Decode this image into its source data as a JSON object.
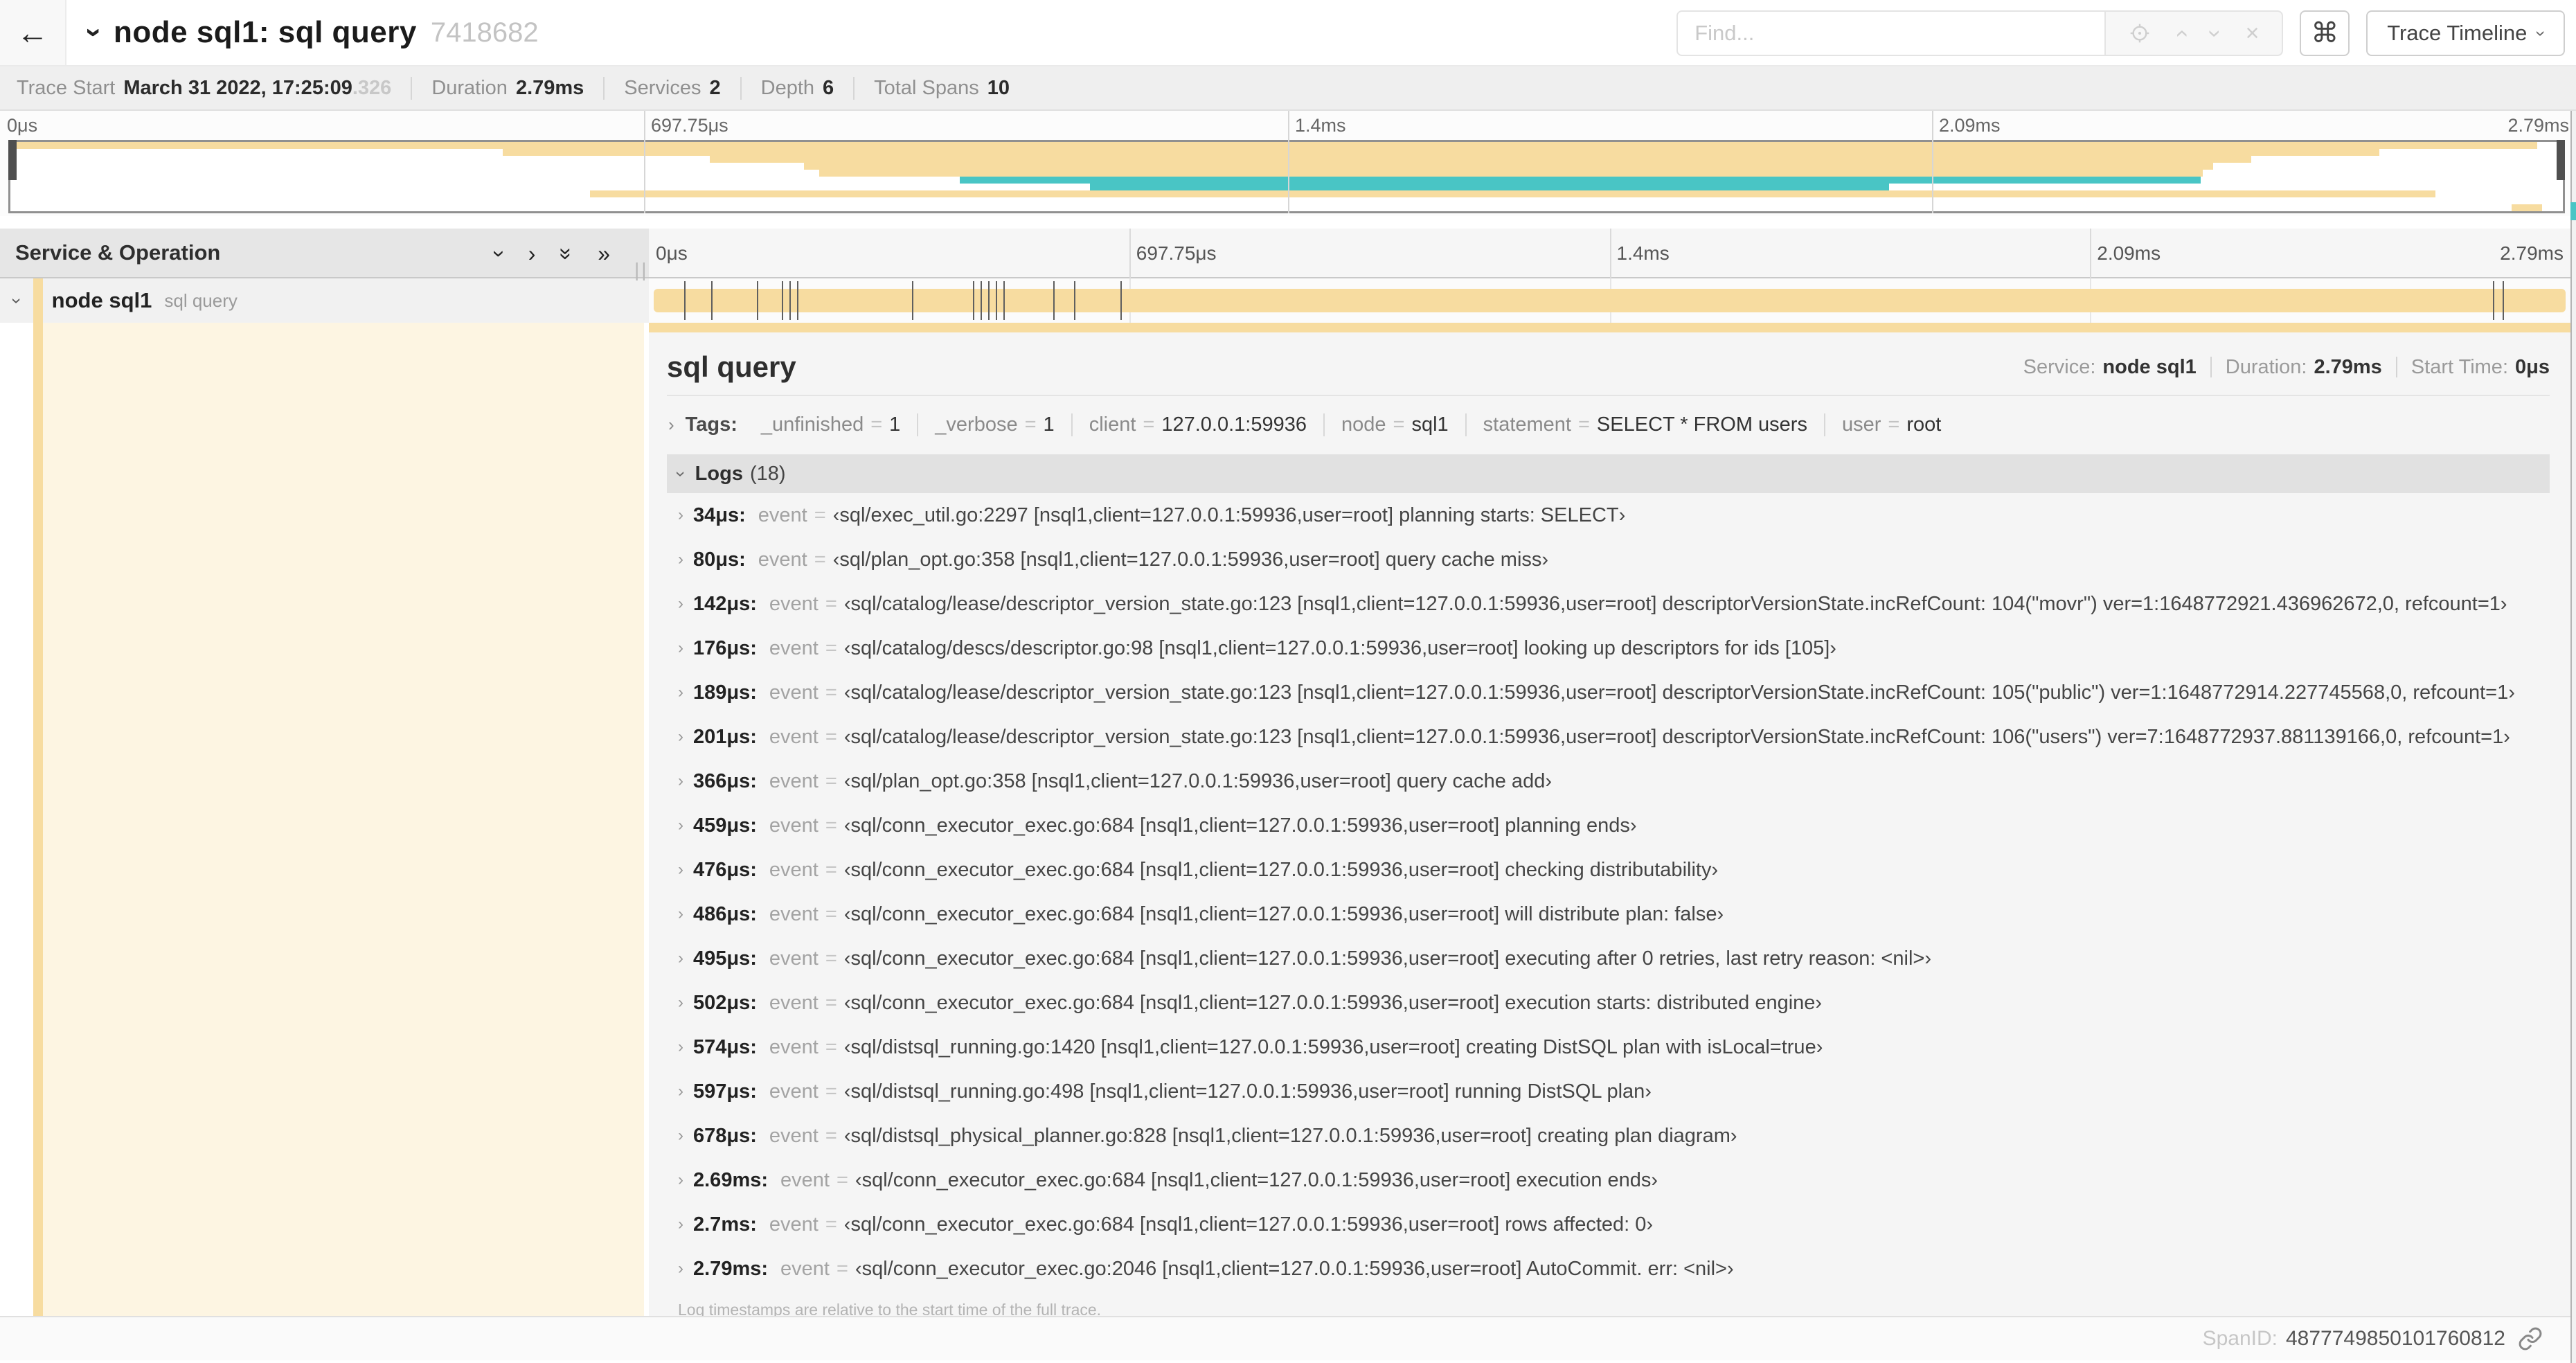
{
  "colors": {
    "span_tan": "#f7dca0",
    "span_teal": "#49c5c5",
    "accent_dark_handle": "#4f4f4f"
  },
  "icons": {
    "back": "←",
    "chevron": "›",
    "double_chevron": "»",
    "close": "×",
    "command": "⌘",
    "resize": "||"
  },
  "header": {
    "title": "node sql1: sql query",
    "trace_id_short": "7418682",
    "find_placeholder": "Find...",
    "trace_timeline_label": "Trace Timeline"
  },
  "trace_info": {
    "items": [
      {
        "label": "Trace Start",
        "value": "March 31 2022, 17:25:09",
        "suffix": ".326"
      },
      {
        "label": "Duration",
        "value": "2.79ms"
      },
      {
        "label": "Services",
        "value": "2"
      },
      {
        "label": "Depth",
        "value": "6"
      },
      {
        "label": "Total Spans",
        "value": "10"
      }
    ]
  },
  "timeline": {
    "ticks": [
      {
        "label": "0μs",
        "pct": 0,
        "line": false
      },
      {
        "label": "697.75μs",
        "pct": 25,
        "line": true
      },
      {
        "label": "1.4ms",
        "pct": 50,
        "line": true
      },
      {
        "label": "2.09ms",
        "pct": 75,
        "line": true
      },
      {
        "label": "2.79ms",
        "pct": 100,
        "line": false
      }
    ],
    "minimap_rows": [
      {
        "row": 0,
        "start": 0.0,
        "end": 0.99,
        "color": "tan"
      },
      {
        "row": 1,
        "start": 0.193,
        "end": 0.928,
        "color": "tan"
      },
      {
        "row": 2,
        "start": 0.274,
        "end": 0.878,
        "color": "tan"
      },
      {
        "row": 3,
        "start": 0.311,
        "end": 0.863,
        "color": "tan"
      },
      {
        "row": 4,
        "start": 0.317,
        "end": 0.859,
        "color": "tan"
      },
      {
        "row": 5,
        "start": 0.372,
        "end": 0.858,
        "color": "teal"
      },
      {
        "row": 6,
        "start": 0.423,
        "end": 0.736,
        "color": "teal"
      },
      {
        "row": 7,
        "start": 0.227,
        "end": 0.95,
        "color": "tan"
      },
      {
        "row": 9,
        "start": 0.98,
        "end": 0.992,
        "color": "tan"
      }
    ],
    "span_log_ticks": [
      0.016,
      0.03,
      0.054,
      0.067,
      0.071,
      0.075,
      0.135,
      0.167,
      0.171,
      0.175,
      0.179,
      0.183,
      0.209,
      0.22,
      0.244,
      0.962,
      0.967
    ]
  },
  "left_panel": {
    "header": "Service & Operation",
    "row": {
      "service": "node sql1",
      "operation": "sql query"
    }
  },
  "detail": {
    "operation": "sql query",
    "service_label": "Service:",
    "service": "node sql1",
    "duration_label": "Duration:",
    "duration": "2.79ms",
    "start_label": "Start Time:",
    "start": "0μs",
    "tags_label": "Tags:",
    "tags": [
      {
        "key": "_unfinished",
        "value": "1"
      },
      {
        "key": "_verbose",
        "value": "1"
      },
      {
        "key": "client",
        "value": "127.0.0.1:59936"
      },
      {
        "key": "node",
        "value": "sql1"
      },
      {
        "key": "statement",
        "value": "SELECT * FROM users"
      },
      {
        "key": "user",
        "value": "root"
      }
    ],
    "logs_label": "Logs",
    "logs_count": "(18)",
    "log_event_key": "event",
    "logs": [
      {
        "time": "34μs:",
        "text": "‹sql/exec_util.go:2297 [nsql1,client=127.0.0.1:59936,user=root] planning starts: SELECT›"
      },
      {
        "time": "80μs:",
        "text": "‹sql/plan_opt.go:358 [nsql1,client=127.0.0.1:59936,user=root] query cache miss›"
      },
      {
        "time": "142μs:",
        "text": "‹sql/catalog/lease/descriptor_version_state.go:123 [nsql1,client=127.0.0.1:59936,user=root] descriptorVersionState.incRefCount: 104(\"movr\") ver=1:1648772921.436962672,0, refcount=1›"
      },
      {
        "time": "176μs:",
        "text": "‹sql/catalog/descs/descriptor.go:98 [nsql1,client=127.0.0.1:59936,user=root] looking up descriptors for ids [105]›"
      },
      {
        "time": "189μs:",
        "text": "‹sql/catalog/lease/descriptor_version_state.go:123 [nsql1,client=127.0.0.1:59936,user=root] descriptorVersionState.incRefCount: 105(\"public\") ver=1:1648772914.227745568,0, refcount=1›"
      },
      {
        "time": "201μs:",
        "text": "‹sql/catalog/lease/descriptor_version_state.go:123 [nsql1,client=127.0.0.1:59936,user=root] descriptorVersionState.incRefCount: 106(\"users\") ver=7:1648772937.881139166,0, refcount=1›"
      },
      {
        "time": "366μs:",
        "text": "‹sql/plan_opt.go:358 [nsql1,client=127.0.0.1:59936,user=root] query cache add›"
      },
      {
        "time": "459μs:",
        "text": "‹sql/conn_executor_exec.go:684 [nsql1,client=127.0.0.1:59936,user=root] planning ends›"
      },
      {
        "time": "476μs:",
        "text": "‹sql/conn_executor_exec.go:684 [nsql1,client=127.0.0.1:59936,user=root] checking distributability›"
      },
      {
        "time": "486μs:",
        "text": "‹sql/conn_executor_exec.go:684 [nsql1,client=127.0.0.1:59936,user=root] will distribute plan: false›"
      },
      {
        "time": "495μs:",
        "text": "‹sql/conn_executor_exec.go:684 [nsql1,client=127.0.0.1:59936,user=root] executing after 0 retries, last retry reason: <nil>›"
      },
      {
        "time": "502μs:",
        "text": "‹sql/conn_executor_exec.go:684 [nsql1,client=127.0.0.1:59936,user=root] execution starts: distributed engine›"
      },
      {
        "time": "574μs:",
        "text": "‹sql/distsql_running.go:1420 [nsql1,client=127.0.0.1:59936,user=root] creating DistSQL plan with isLocal=true›"
      },
      {
        "time": "597μs:",
        "text": "‹sql/distsql_running.go:498 [nsql1,client=127.0.0.1:59936,user=root] running DistSQL plan›"
      },
      {
        "time": "678μs:",
        "text": "‹sql/distsql_physical_planner.go:828 [nsql1,client=127.0.0.1:59936,user=root] creating plan diagram›"
      },
      {
        "time": "2.69ms:",
        "text": "‹sql/conn_executor_exec.go:684 [nsql1,client=127.0.0.1:59936,user=root] execution ends›"
      },
      {
        "time": "2.7ms:",
        "text": "‹sql/conn_executor_exec.go:684 [nsql1,client=127.0.0.1:59936,user=root] rows affected: 0›"
      },
      {
        "time": "2.79ms:",
        "text": "‹sql/conn_executor_exec.go:2046 [nsql1,client=127.0.0.1:59936,user=root] AutoCommit. err: <nil>›"
      }
    ],
    "logs_note": "Log timestamps are relative to the start time of the full trace.",
    "spanid_label": "SpanID:",
    "spanid": "4877749850101760812"
  }
}
